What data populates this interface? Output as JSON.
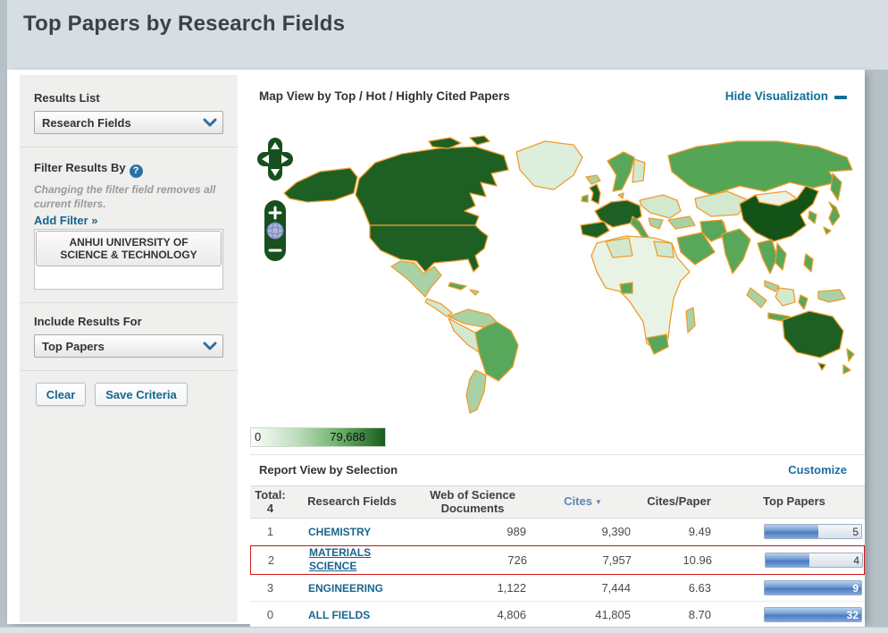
{
  "page": {
    "title": "Top Papers by Research Fields"
  },
  "sidebar": {
    "results_list": {
      "label": "Results List",
      "selected": "Research Fields"
    },
    "filter": {
      "title": "Filter Results By",
      "help_glyph": "?",
      "note": "Changing the filter field removes all current filters.",
      "add_filter": "Add Filter »",
      "active_filter": "ANHUI UNIVERSITY OF SCIENCE & TECHNOLOGY"
    },
    "include_results": {
      "label": "Include Results For",
      "selected": "Top Papers"
    },
    "actions": {
      "clear": "Clear",
      "save": "Save Criteria"
    }
  },
  "visualization": {
    "title": "Map View by Top / Hot / Highly Cited Papers",
    "hide_link": "Hide Visualization",
    "legend": {
      "min": "0",
      "max": "79,688"
    }
  },
  "report": {
    "title": "Report View by Selection",
    "customize": "Customize",
    "header": {
      "total_label": "Total:",
      "total_value": "4",
      "col_field": "Research Fields",
      "col_docs": "Web of Science Documents",
      "col_cites": "Cites",
      "sort_glyph": "▼",
      "col_cpp": "Cites/Paper",
      "col_top": "Top Papers"
    },
    "rows": [
      {
        "rank": "1",
        "field": "CHEMISTRY",
        "docs": "989",
        "cites": "9,390",
        "cites_per_paper": "9.49",
        "top_papers": "5",
        "bar_pct": 56,
        "highlight": false
      },
      {
        "rank": "2",
        "field": "MATERIALS SCIENCE",
        "docs": "726",
        "cites": "7,957",
        "cites_per_paper": "10.96",
        "top_papers": "4",
        "bar_pct": 45,
        "highlight": true
      },
      {
        "rank": "3",
        "field": "ENGINEERING",
        "docs": "1,122",
        "cites": "7,444",
        "cites_per_paper": "6.63",
        "top_papers": "9",
        "bar_pct": 100,
        "highlight": false
      },
      {
        "rank": "0",
        "field": "ALL FIELDS",
        "docs": "4,806",
        "cites": "41,805",
        "cites_per_paper": "8.70",
        "top_papers": "32",
        "bar_pct": 100,
        "highlight": false
      }
    ]
  },
  "colors": {
    "accent_link": "#17658f",
    "hide_link": "#0d7096",
    "highlight_border": "#cf1a1a",
    "map_border": "#f09c2b",
    "map_dark_green": "#1e6023",
    "map_darkest_green": "#145318",
    "bar_fill_blue": "#4a7ac0"
  }
}
